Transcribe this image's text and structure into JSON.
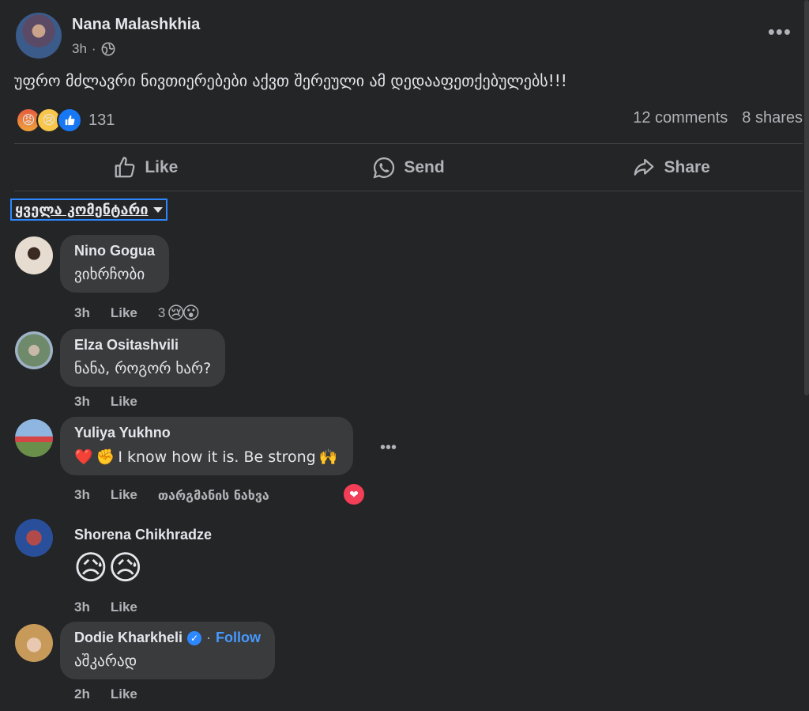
{
  "post": {
    "author": "Nana Malashkhia",
    "time": "3h",
    "text": "უფრო მძლავრი  ნივთიერებები აქვთ შერეული ამ დედააფეთქებულებს!!!",
    "reaction_count": "131",
    "comments": "12 comments",
    "shares": "8 shares",
    "more_icon": "more-dots-icon"
  },
  "actions": {
    "like": "Like",
    "send": "Send",
    "share": "Share"
  },
  "filter": {
    "label": "ყველა კომენტარი"
  },
  "comments": [
    {
      "name": "Nino Gogua",
      "text": "ვიხრჩობი",
      "time": "3h",
      "like": "Like",
      "reaction_count": "3"
    },
    {
      "name": "Elza Ositashvili",
      "text": "ნანა, როგორ ხარ?",
      "time": "3h",
      "like": "Like"
    },
    {
      "name": "Yuliya Yukhno",
      "text": "I know how it is. Be strong",
      "time": "3h",
      "like": "Like",
      "translate": "თარგმანის ნახვა"
    },
    {
      "name": "Shorena Chikhradze",
      "text": "😥😥",
      "time": "3h",
      "like": "Like"
    },
    {
      "name": "Dodie Kharkheli",
      "text": "აშკარად",
      "time": "2h",
      "like": "Like",
      "follow": "Follow"
    }
  ],
  "colors": {
    "background": "#242526",
    "bubble": "#3a3b3c",
    "accent": "#2d88ff"
  }
}
